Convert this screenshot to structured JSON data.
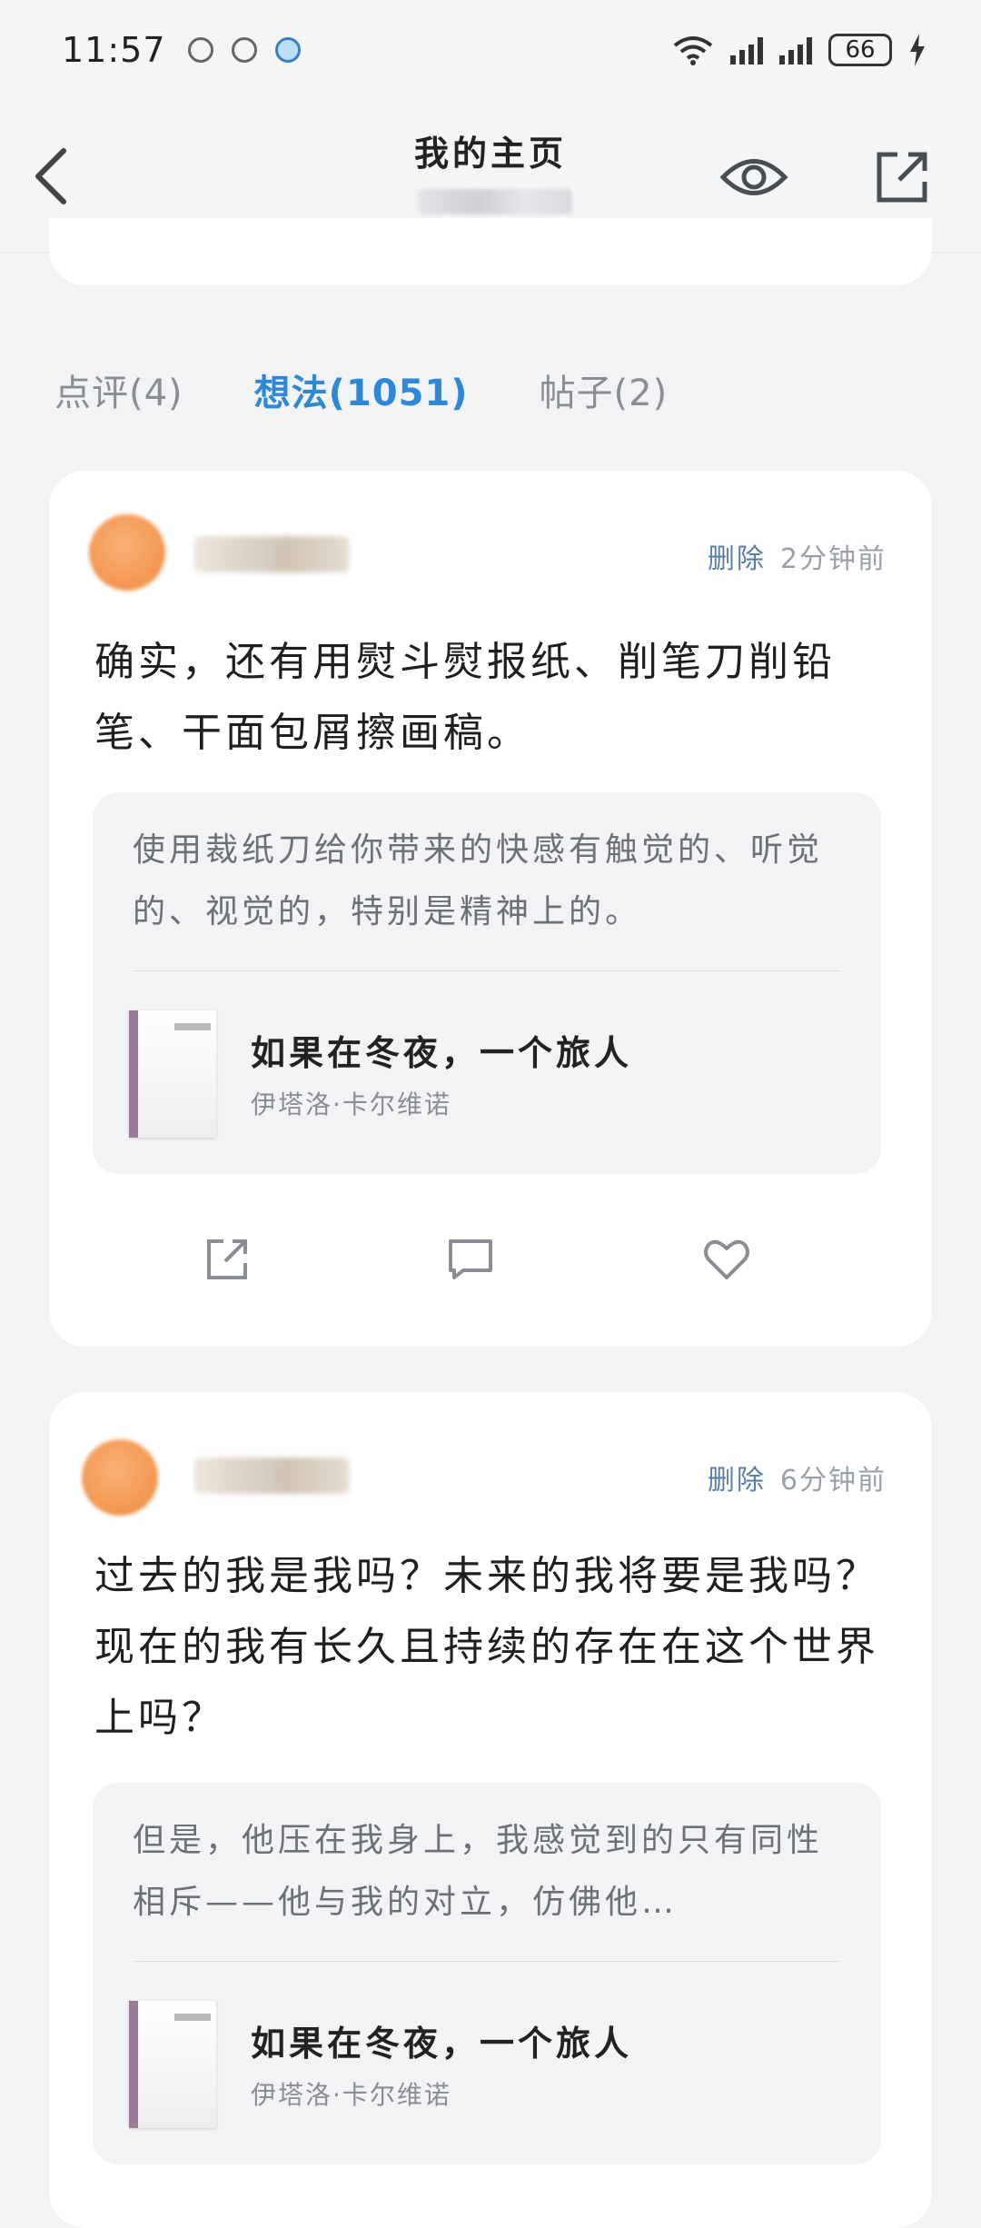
{
  "status_bar": {
    "time": "11:57",
    "battery": "66"
  },
  "nav": {
    "title": "我的主页"
  },
  "tabs": [
    {
      "label": "点评(4)",
      "active": false
    },
    {
      "label": "想法(1051)",
      "active": true
    },
    {
      "label": "帖子(2)",
      "active": false
    }
  ],
  "posts": [
    {
      "delete_label": "删除",
      "time_ago": "2分钟前",
      "thought": "确实，还有用熨斗熨报纸、削笔刀削铅笔、干面包屑擦画稿。",
      "quote": "使用裁纸刀给你带来的快感有触觉的、听觉的、视觉的，特别是精神上的。",
      "book_title": "如果在冬夜，一个旅人",
      "book_author": "伊塔洛·卡尔维诺"
    },
    {
      "delete_label": "删除",
      "time_ago": "6分钟前",
      "thought": "过去的我是我吗？未来的我将要是我吗？现在的我有长久且持续的存在在这个世界上吗？",
      "quote": "但是，他压在我身上，我感觉到的只有同性相斥——他与我的对立，仿佛他…",
      "book_title": "如果在冬夜，一个旅人",
      "book_author": "伊塔洛·卡尔维诺"
    }
  ],
  "colors": {
    "accent": "#2f87d8",
    "background": "#f2f3f5"
  }
}
